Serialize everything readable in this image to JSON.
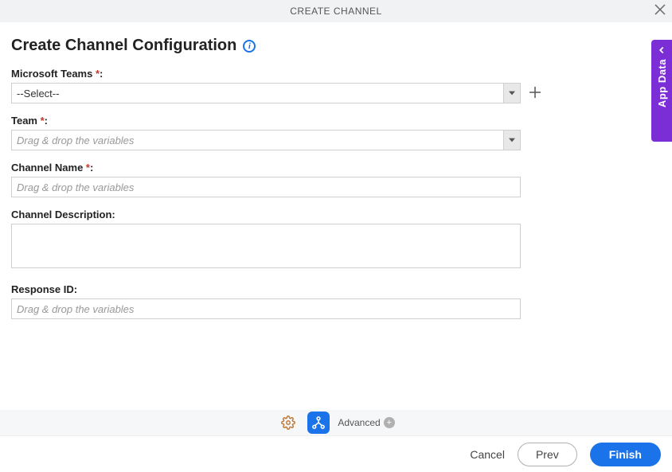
{
  "header": {
    "title": "CREATE CHANNEL"
  },
  "page": {
    "title": "Create Channel Configuration"
  },
  "fields": {
    "msteams": {
      "label": "Microsoft Teams ",
      "value": "--Select--"
    },
    "team": {
      "label": "Team ",
      "placeholder": "Drag & drop the variables"
    },
    "channel_name": {
      "label": "Channel Name ",
      "placeholder": "Drag & drop the variables"
    },
    "channel_desc": {
      "label": "Channel Description:"
    },
    "response_id": {
      "label": "Response ID:",
      "placeholder": "Drag & drop the variables"
    }
  },
  "toolbar": {
    "advanced": "Advanced"
  },
  "footer": {
    "cancel": "Cancel",
    "prev": "Prev",
    "finish": "Finish"
  },
  "side": {
    "label": "App Data"
  }
}
